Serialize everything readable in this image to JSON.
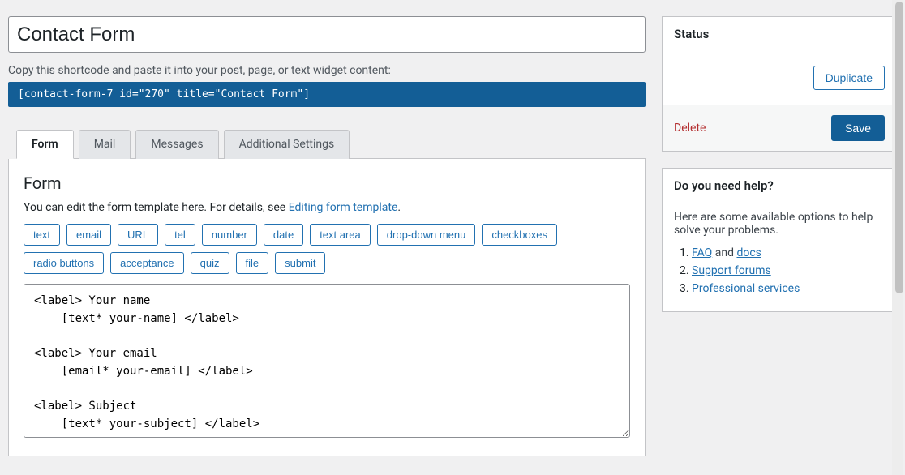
{
  "title": "Contact Form",
  "shortcode_label": "Copy this shortcode and paste it into your post, page, or text widget content:",
  "shortcode_value": "[contact-form-7 id=\"270\" title=\"Contact Form\"]",
  "tabs": [
    "Form",
    "Mail",
    "Messages",
    "Additional Settings"
  ],
  "active_tab": 0,
  "form_panel": {
    "heading": "Form",
    "desc_prefix": "You can edit the form template here. For details, see ",
    "desc_link": "Editing form template",
    "desc_suffix": ".",
    "tag_buttons": [
      "text",
      "email",
      "URL",
      "tel",
      "number",
      "date",
      "text area",
      "drop-down menu",
      "checkboxes",
      "radio buttons",
      "acceptance",
      "quiz",
      "file",
      "submit"
    ],
    "template": "<label> Your name\n    [text* your-name] </label>\n\n<label> Your email\n    [email* your-email] </label>\n\n<label> Subject\n    [text* your-subject] </label>"
  },
  "status_box": {
    "heading": "Status",
    "duplicate": "Duplicate",
    "delete": "Delete",
    "save": "Save"
  },
  "help_box": {
    "heading": "Do you need help?",
    "desc": "Here are some available options to help solve your problems.",
    "items": [
      {
        "links": [
          "FAQ",
          "docs"
        ],
        "joiner": " and "
      },
      {
        "links": [
          "Support forums"
        ]
      },
      {
        "links": [
          "Professional services"
        ]
      }
    ]
  }
}
